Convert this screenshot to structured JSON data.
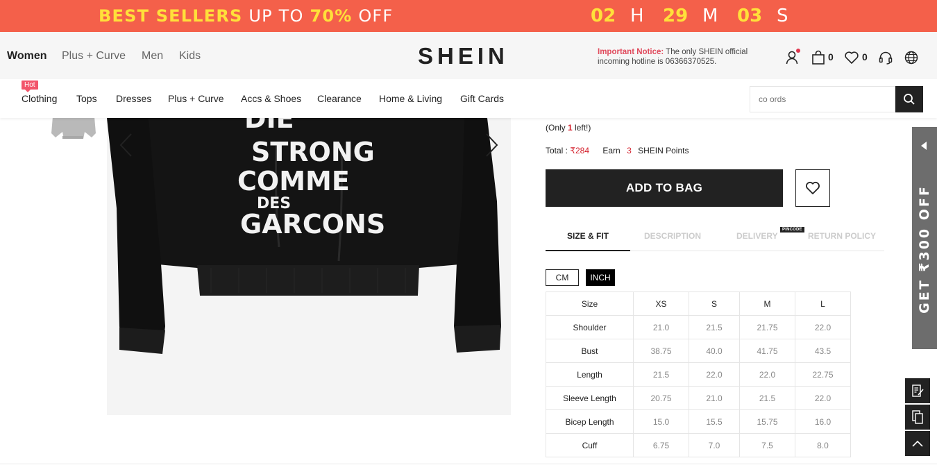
{
  "promo": {
    "lead": "BEST SELLERS",
    "middle": "UP TO",
    "discount": "70%",
    "tail": "OFF",
    "timer": {
      "hours": "02",
      "h_label": "H",
      "minutes": "29",
      "m_label": "M",
      "seconds": "03",
      "s_label": "S"
    }
  },
  "header": {
    "nav": [
      "Women",
      "Plus + Curve",
      "Men",
      "Kids"
    ],
    "logo": "SHEIN",
    "notice_label": "Important Notice:",
    "notice_text": "The only SHEIN official incoming hotline is 06366370525.",
    "bag_count": "0",
    "wishlist_count": "0"
  },
  "categories": {
    "hot_badge": "Hot",
    "items": [
      "Clothing",
      "Tops",
      "Dresses",
      "Plus + Curve",
      "Accs & Shoes",
      "Clearance",
      "Home & Living",
      "Gift Cards"
    ],
    "search_placeholder": "co ords"
  },
  "product": {
    "print_lines": [
      "DIE",
      "STRONG",
      "COMME",
      "DES",
      "GARCONS"
    ],
    "stock_prefix": "(Only",
    "stock_count": "1",
    "stock_suffix": "left!)",
    "total_label": "Total :",
    "total_price": "₹284",
    "earn_label": "Earn",
    "points": "3",
    "points_label": "SHEIN Points",
    "add_to_bag": "ADD TO BAG"
  },
  "tabs": [
    "SIZE & FIT",
    "DESCRIPTION",
    "DELIVERY",
    "RETURN POLICY"
  ],
  "pincode_badge": "PINCODE",
  "units": {
    "cm": "CM",
    "inch": "INCH"
  },
  "size_table": {
    "headers": [
      "Size",
      "XS",
      "S",
      "M",
      "L"
    ],
    "rows": [
      [
        "Shoulder",
        "21.0",
        "21.5",
        "21.75",
        "22.0"
      ],
      [
        "Bust",
        "38.75",
        "40.0",
        "41.75",
        "43.5"
      ],
      [
        "Length",
        "21.5",
        "22.0",
        "22.0",
        "22.75"
      ],
      [
        "Sleeve Length",
        "20.75",
        "21.0",
        "21.5",
        "22.0"
      ],
      [
        "Bicep Length",
        "15.0",
        "15.5",
        "15.75",
        "16.0"
      ],
      [
        "Cuff",
        "6.75",
        "7.0",
        "7.5",
        "8.0"
      ]
    ]
  },
  "side_promo": "GET ₹300 OFF",
  "colors": {
    "promo_bg": "#f4604a",
    "promo_yellow": "#ffe03a",
    "price_red": "#d4202c",
    "dark": "#222222"
  },
  "icons": [
    "user-icon",
    "bag-icon",
    "heart-icon",
    "headset-icon",
    "globe-icon",
    "search-icon",
    "chevron-left-icon",
    "chevron-right-icon",
    "edit-icon",
    "copy-icon",
    "arrow-up-icon"
  ]
}
